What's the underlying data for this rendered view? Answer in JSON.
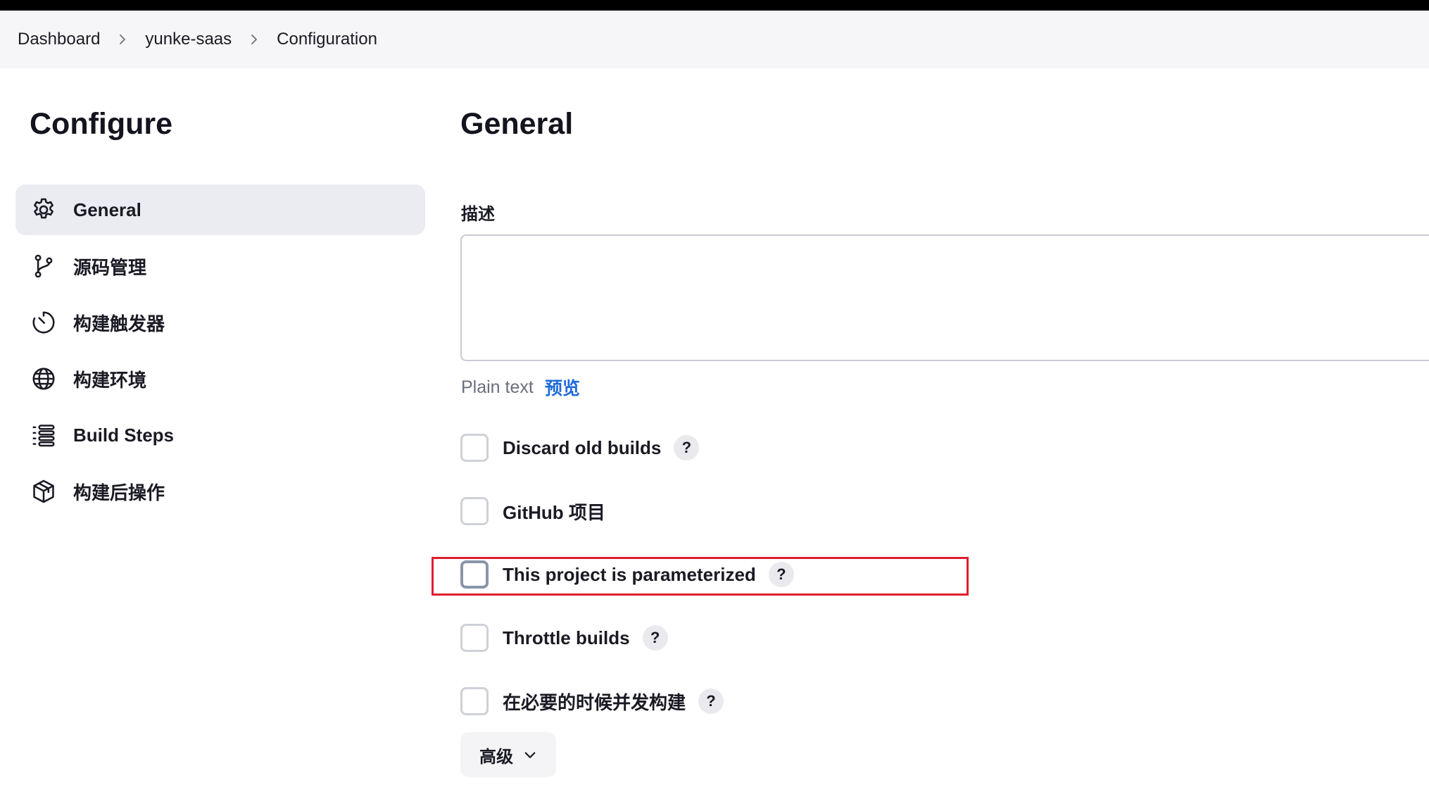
{
  "breadcrumb": {
    "items": [
      "Dashboard",
      "yunke-saas",
      "Configuration"
    ]
  },
  "sidebar": {
    "title": "Configure",
    "items": [
      {
        "label": "General",
        "icon": "gear-icon",
        "active": true
      },
      {
        "label": "源码管理",
        "icon": "git-branch-icon",
        "active": false
      },
      {
        "label": "构建触发器",
        "icon": "timer-icon",
        "active": false
      },
      {
        "label": "构建环境",
        "icon": "globe-icon",
        "active": false
      },
      {
        "label": "Build Steps",
        "icon": "list-icon",
        "active": false
      },
      {
        "label": "构建后操作",
        "icon": "package-icon",
        "active": false
      }
    ]
  },
  "main": {
    "title": "General",
    "description": {
      "label": "描述",
      "value": "",
      "format": "Plain text",
      "preview": "预览"
    },
    "options": [
      {
        "label": "Discard old builds",
        "checked": false,
        "help": "?"
      },
      {
        "label": "GitHub 项目",
        "checked": false,
        "help": ""
      },
      {
        "label": "This project is parameterized",
        "checked": false,
        "help": "?",
        "highlighted": true
      },
      {
        "label": "Throttle builds",
        "checked": false,
        "help": "?"
      },
      {
        "label": "在必要的时候并发构建",
        "checked": false,
        "help": "?"
      }
    ],
    "advanced_label": "高级"
  },
  "colors": {
    "highlight": "#e01d2d",
    "link": "#1f6ad8",
    "active_bg": "#ebebf2"
  }
}
